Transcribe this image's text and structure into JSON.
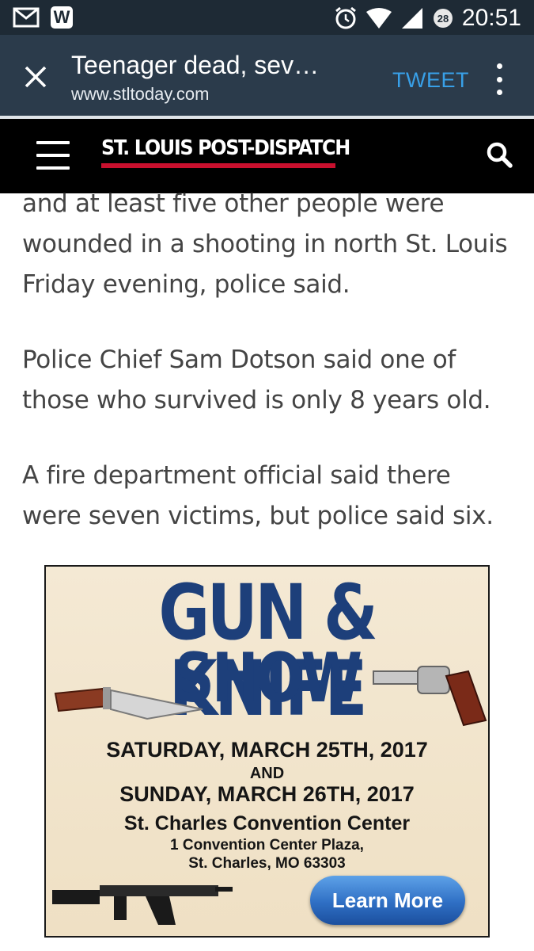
{
  "status_bar": {
    "time": "20:51",
    "notification_count": "28",
    "w_badge": "W",
    "icons": [
      "gmail-icon",
      "w-app-icon",
      "alarm-icon",
      "wifi-icon",
      "signal-icon",
      "battery-icon"
    ]
  },
  "toolbar": {
    "title": "Teenager dead, sev…",
    "url": "www.stltoday.com",
    "tweet_label": "TWEET",
    "tweet_color": "#38a0e8"
  },
  "site_header": {
    "logo": "ST. LOUIS POST-DISPATCH",
    "logo_accent": "#c8102e"
  },
  "article": {
    "paragraphs": [
      "and at least five other people were wounded in a shooting in north St. Louis Friday evening, police said.",
      "Police Chief Sam Dotson said one of those who survived is only 8 years old.",
      "A fire department official said there were seven victims, but police said six."
    ]
  },
  "ad": {
    "title_line1": "GUN & KNIFE",
    "title_line2": "SHOW",
    "date1": "SATURDAY, MARCH 25TH, 2017",
    "and": "AND",
    "date2": "SUNDAY, MARCH 26TH, 2017",
    "venue": "St. Charles Convention Center",
    "address1": "1 Convention Center Plaza,",
    "address2": "St. Charles, MO 63303",
    "cta": "Learn More"
  }
}
